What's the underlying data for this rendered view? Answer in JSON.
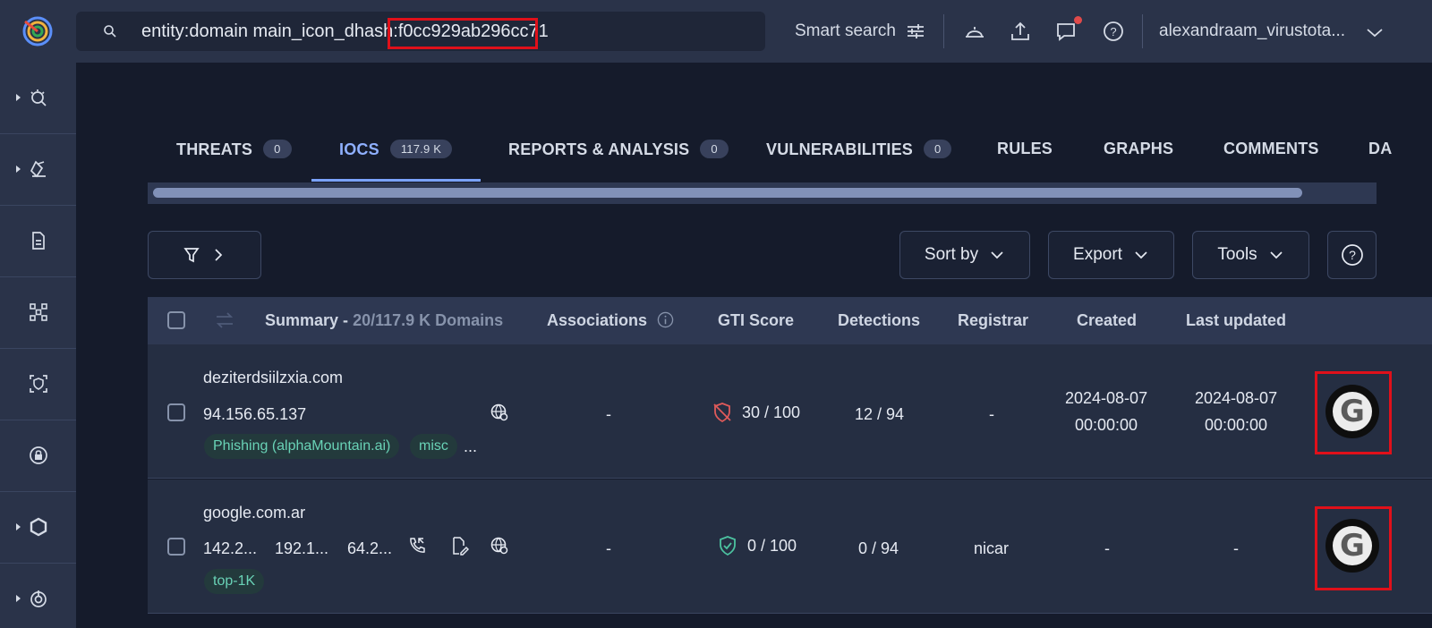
{
  "search": {
    "query": "entity:domain main_icon_dhash:f0cc929ab296cc71",
    "smart_search_label": "Smart search"
  },
  "header": {
    "username": "alexandraam_virustota..."
  },
  "tabs": [
    {
      "label": "THREATS",
      "count": "0"
    },
    {
      "label": "IOCS",
      "count": "117.9 K"
    },
    {
      "label": "REPORTS & ANALYSIS",
      "count": "0"
    },
    {
      "label": "VULNERABILITIES",
      "count": "0"
    },
    {
      "label": "RULES"
    },
    {
      "label": "GRAPHS"
    },
    {
      "label": "COMMENTS"
    },
    {
      "label": "DA"
    }
  ],
  "toolbar": {
    "sort_label": "Sort by",
    "export_label": "Export",
    "tools_label": "Tools",
    "help_label": "?"
  },
  "table": {
    "headers": {
      "summary": "Summary -",
      "summary_count": "20/117.9 K Domains",
      "associations": "Associations",
      "gti_score": "GTI Score",
      "detections": "Detections",
      "registrar": "Registrar",
      "created": "Created",
      "last_updated": "Last updated"
    },
    "rows": [
      {
        "domain": "deziterdsiilzxia.com",
        "ips": [
          "94.156.65.137"
        ],
        "tags": [
          "Phishing (alphaMountain.ai)",
          "misc"
        ],
        "more": "...",
        "associations": "-",
        "gti_score": "30 / 100",
        "gti_status": "malicious",
        "detections": "12 / 94",
        "registrar": "-",
        "created_date": "2024-08-07",
        "created_time": "00:00:00",
        "updated_date": "2024-08-07",
        "updated_time": "00:00:00",
        "favicon": "G"
      },
      {
        "domain": "google.com.ar",
        "ips": [
          "142.2...",
          "192.1...",
          "64.2..."
        ],
        "tags": [
          "top-1K"
        ],
        "associations": "-",
        "gti_score": "0 / 100",
        "gti_status": "clean",
        "detections": "0 / 94",
        "registrar": "nicar",
        "created": "-",
        "last_updated": "-",
        "favicon": "G"
      }
    ]
  },
  "colors": {
    "accent": "#7aa2ff",
    "highlight": "#e0101a",
    "tag_text": "#69d2b6",
    "malicious": "#e05a5a",
    "clean": "#4cc2a0"
  }
}
